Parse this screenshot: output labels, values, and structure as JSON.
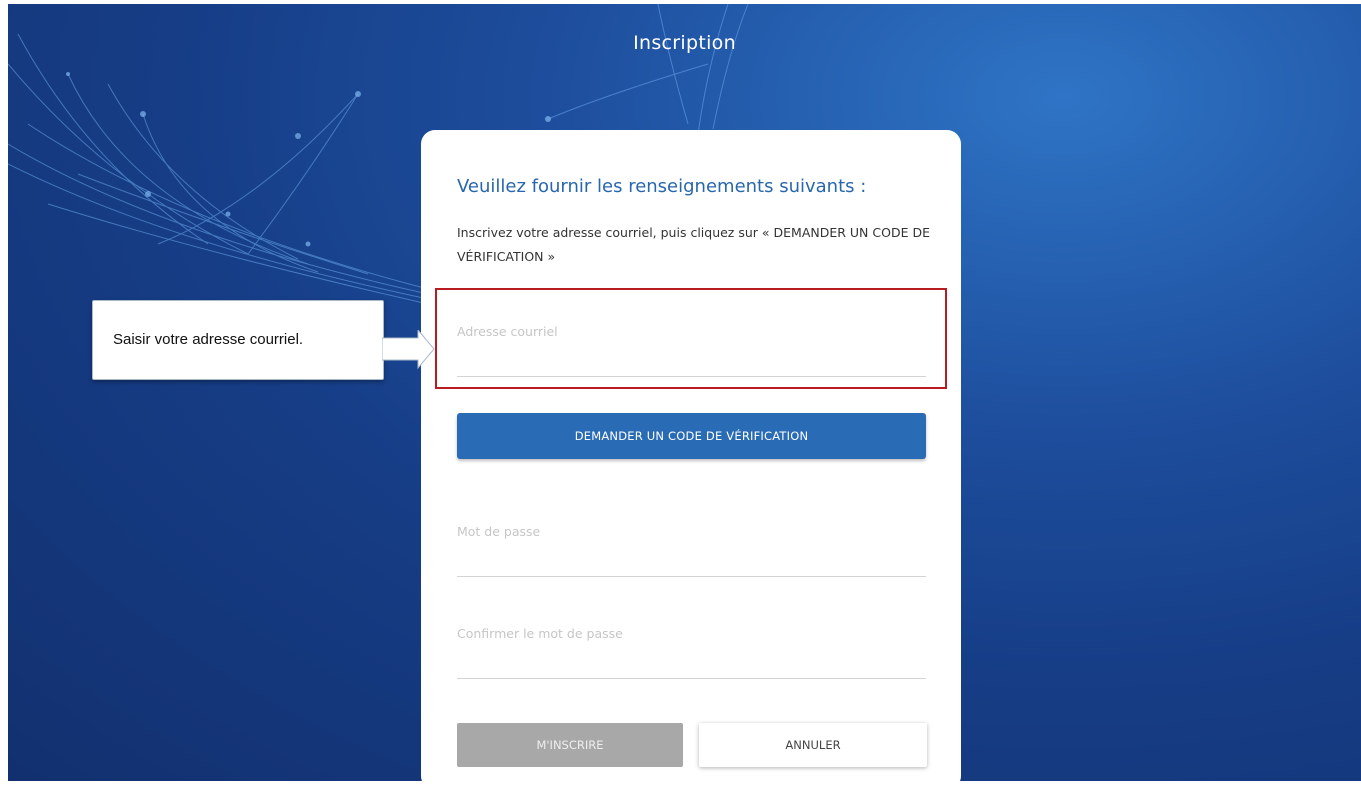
{
  "page": {
    "title": "Inscription"
  },
  "card": {
    "heading": "Veuillez fournir les renseignements suivants :",
    "instructions": "Inscrivez votre adresse courriel, puis cliquez sur « DEMANDER UN CODE DE VÉRIFICATION »"
  },
  "email_field": {
    "placeholder": "Adresse courriel",
    "value": ""
  },
  "verify_button": {
    "label": "DEMANDER UN CODE DE VÉRIFICATION"
  },
  "password_field": {
    "placeholder": "Mot de passe",
    "value": ""
  },
  "confirm_password_field": {
    "placeholder": "Confirmer le mot de passe",
    "value": ""
  },
  "signup_button": {
    "label": "M'INSCRIRE"
  },
  "cancel_button": {
    "label": "ANNULER"
  },
  "callout": {
    "text": "Saisir votre adresse courriel."
  },
  "colors": {
    "background": "#163d86",
    "heading": "#2867ad",
    "primary_button": "#2a6bb5",
    "disabled_button": "#a8a8a8",
    "highlight": "#b81c22"
  }
}
